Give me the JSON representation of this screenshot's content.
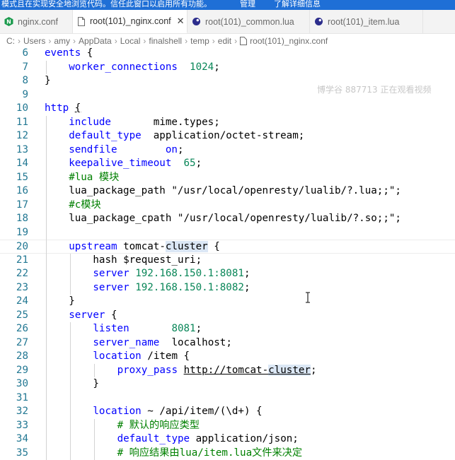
{
  "banner": {
    "message": "模式且在实现安全地浏览代码。信任此窗口以启用所有功能。",
    "manage": "管理",
    "learn_more": "了解详细信息"
  },
  "tabs": [
    {
      "label": "nginx.conf",
      "icon": "nginx-n-icon",
      "active": false
    },
    {
      "label": "root(101)_nginx.conf",
      "icon": "file-icon",
      "active": true
    },
    {
      "label": "root(101)_common.lua",
      "icon": "lua-moon-icon",
      "active": false
    },
    {
      "label": "root(101)_item.lua",
      "icon": "lua-moon-icon",
      "active": false
    }
  ],
  "breadcrumb": [
    "C:",
    "Users",
    "amy",
    "AppData",
    "Local",
    "finalshell",
    "temp",
    "edit",
    "root(101)_nginx.conf"
  ],
  "watermark": "博学谷 887713 正在观看视频",
  "colors": {
    "accent": "#1f6fd6",
    "keyword": "#0000ff",
    "number": "#098658",
    "comment": "#008000",
    "line_number": "#237893"
  },
  "editor": {
    "lines": [
      {
        "n": "6",
        "indent": 0,
        "parts": [
          [
            "kw",
            "events"
          ],
          [
            "t",
            " {"
          ]
        ]
      },
      {
        "n": "7",
        "indent": 1,
        "parts": [
          [
            "dir",
            "worker_connections"
          ],
          [
            "t",
            "  "
          ],
          [
            "num",
            "1024"
          ],
          [
            "t",
            ";"
          ]
        ]
      },
      {
        "n": "8",
        "indent": 0,
        "parts": [
          [
            "t",
            "}"
          ]
        ]
      },
      {
        "n": "9",
        "indent": 0,
        "parts": []
      },
      {
        "n": "10",
        "indent": 0,
        "parts": [
          [
            "kw",
            "http"
          ],
          [
            "t",
            " "
          ],
          [
            "ul",
            "{"
          ]
        ]
      },
      {
        "n": "11",
        "indent": 1,
        "parts": [
          [
            "dir",
            "include"
          ],
          [
            "t",
            "       mime.types;"
          ]
        ]
      },
      {
        "n": "12",
        "indent": 1,
        "parts": [
          [
            "dir",
            "default_type"
          ],
          [
            "t",
            "  application/octet-stream;"
          ]
        ]
      },
      {
        "n": "13",
        "indent": 1,
        "parts": [
          [
            "dir",
            "sendfile"
          ],
          [
            "t",
            "        "
          ],
          [
            "kw",
            "on"
          ],
          [
            "t",
            ";"
          ]
        ]
      },
      {
        "n": "14",
        "indent": 1,
        "parts": [
          [
            "dir",
            "keepalive_timeout"
          ],
          [
            "t",
            "  "
          ],
          [
            "num",
            "65"
          ],
          [
            "t",
            ";"
          ]
        ]
      },
      {
        "n": "15",
        "indent": 1,
        "parts": [
          [
            "cmt",
            "#lua 模块"
          ]
        ]
      },
      {
        "n": "16",
        "indent": 1,
        "parts": [
          [
            "t",
            "lua_package_path \"/usr/local/openresty/lualib/?.lua;;\";"
          ]
        ]
      },
      {
        "n": "17",
        "indent": 1,
        "parts": [
          [
            "cmt",
            "#c模块"
          ]
        ]
      },
      {
        "n": "18",
        "indent": 1,
        "parts": [
          [
            "t",
            "lua_package_cpath \"/usr/local/openresty/lualib/?.so;;\";"
          ]
        ]
      },
      {
        "n": "19",
        "indent": 0,
        "parts": []
      },
      {
        "n": "20",
        "indent": 1,
        "current": true,
        "parts": [
          [
            "dir",
            "upstream"
          ],
          [
            "t",
            " tomcat-"
          ],
          [
            "hl",
            "cluster"
          ],
          [
            "t",
            " {"
          ]
        ]
      },
      {
        "n": "21",
        "indent": 2,
        "parts": [
          [
            "t",
            "hash $request_uri;"
          ]
        ]
      },
      {
        "n": "22",
        "indent": 2,
        "parts": [
          [
            "dir",
            "server"
          ],
          [
            "t",
            " "
          ],
          [
            "num",
            "192.168.150.1:8081"
          ],
          [
            "t",
            ";"
          ]
        ]
      },
      {
        "n": "23",
        "indent": 2,
        "parts": [
          [
            "dir",
            "server"
          ],
          [
            "t",
            " "
          ],
          [
            "num",
            "192.168.150.1:8082"
          ],
          [
            "t",
            ";"
          ]
        ]
      },
      {
        "n": "24",
        "indent": 1,
        "parts": [
          [
            "t",
            "}"
          ]
        ]
      },
      {
        "n": "25",
        "indent": 1,
        "parts": [
          [
            "dir",
            "server"
          ],
          [
            "t",
            " {"
          ]
        ]
      },
      {
        "n": "26",
        "indent": 2,
        "parts": [
          [
            "dir",
            "listen"
          ],
          [
            "t",
            "       "
          ],
          [
            "num",
            "8081"
          ],
          [
            "t",
            ";"
          ]
        ]
      },
      {
        "n": "27",
        "indent": 2,
        "parts": [
          [
            "dir",
            "server_name"
          ],
          [
            "t",
            "  localhost;"
          ]
        ]
      },
      {
        "n": "28",
        "indent": 2,
        "parts": [
          [
            "dir",
            "location"
          ],
          [
            "t",
            " /item {"
          ]
        ]
      },
      {
        "n": "29",
        "indent": 3,
        "parts": [
          [
            "dir",
            "proxy_pass"
          ],
          [
            "t",
            " "
          ],
          [
            "ul",
            "http://tomcat-"
          ],
          [
            "ulhl",
            "cluster"
          ],
          [
            "t",
            ";"
          ]
        ]
      },
      {
        "n": "30",
        "indent": 2,
        "parts": [
          [
            "t",
            "}"
          ]
        ]
      },
      {
        "n": "31",
        "indent": 0,
        "parts": []
      },
      {
        "n": "32",
        "indent": 2,
        "parts": [
          [
            "dir",
            "location"
          ],
          [
            "t",
            " ~ /api/item/(\\d+) {"
          ]
        ]
      },
      {
        "n": "33",
        "indent": 3,
        "parts": [
          [
            "cmt",
            "# 默认的响应类型"
          ]
        ]
      },
      {
        "n": "34",
        "indent": 3,
        "parts": [
          [
            "dir",
            "default_type"
          ],
          [
            "t",
            " application/json;"
          ]
        ]
      },
      {
        "n": "35",
        "indent": 3,
        "parts": [
          [
            "cmt",
            "# 响应结果由lua/item.lua文件来决定"
          ]
        ]
      }
    ]
  }
}
